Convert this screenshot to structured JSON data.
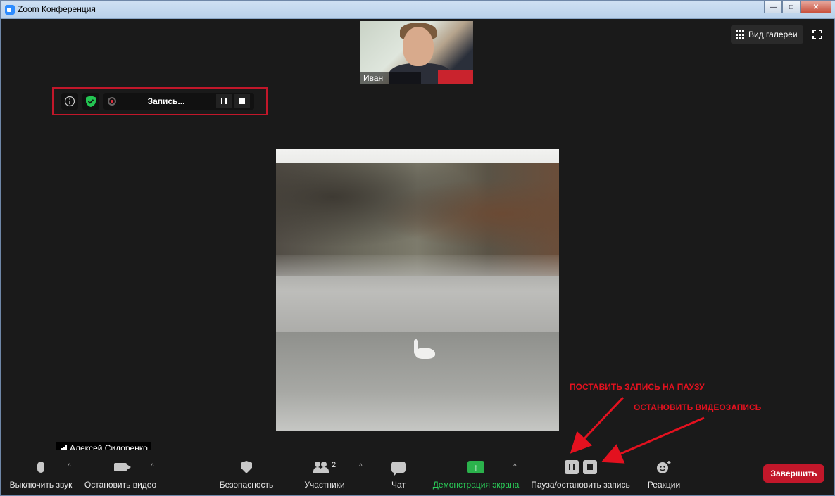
{
  "window": {
    "title": "Zoom Конференция",
    "minimize": "—",
    "maximize": "□",
    "close": "✕"
  },
  "top_video": {
    "name": "Иван"
  },
  "gallery": {
    "label": "Вид галереи"
  },
  "recording_bar": {
    "status": "Запись..."
  },
  "self_view": {
    "name": "Алексей Сидоренко"
  },
  "toolbar": {
    "mute": "Выключить звук",
    "video": "Остановить видео",
    "security": "Безопасность",
    "participants": "Участники",
    "participants_count": "2",
    "chat": "Чат",
    "share": "Демонстрация экрана",
    "pause_stop": "Пауза/остановить запись",
    "reactions": "Реакции",
    "end": "Завершить",
    "caret": "^"
  },
  "annotations": {
    "pause": "ПОСТАВИТЬ ЗАПИСЬ НА ПАУЗУ",
    "stop": "ОСТАНОВИТЬ ВИДЕОЗАПИСЬ"
  },
  "colors": {
    "accent_red": "#c2172a",
    "share_green": "#2bb24c",
    "annotation_red": "#e3111f"
  }
}
